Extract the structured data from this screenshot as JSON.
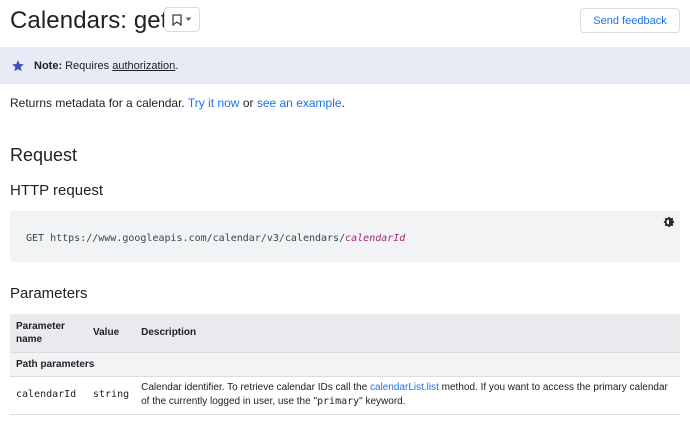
{
  "header": {
    "title": "Calendars: get",
    "feedback_label": "Send feedback"
  },
  "note": {
    "label": "Note:",
    "text": "Requires",
    "link": "authorization",
    "trailing": "."
  },
  "description": {
    "text": "Returns metadata for a calendar.",
    "link1": "Try it now",
    "middle": "or",
    "link2": "see an example",
    "trailing": "."
  },
  "sections": {
    "request": "Request",
    "http_request": "HTTP request",
    "parameters": "Parameters"
  },
  "http": {
    "method": "GET",
    "url": "https://www.googleapis.com/calendar/v3/calendars/",
    "var": "calendarId"
  },
  "table": {
    "headers": [
      "Parameter name",
      "Value",
      "Description"
    ],
    "group_label": "Path parameters",
    "rows": [
      {
        "name": "calendarId",
        "value": "string",
        "desc_pre": "Calendar identifier. To retrieve calendar IDs call the ",
        "desc_link": "calendarList.list",
        "desc_mid": " method. If you want to access the primary calendar of the currently logged in user, use the \"",
        "desc_code": "primary",
        "desc_post": "\" keyword."
      }
    ]
  },
  "colors": {
    "accent": "#1a73e8",
    "note_bg": "#e8eaf6",
    "star": "#3f51b5",
    "code_var": "#a8277c"
  }
}
